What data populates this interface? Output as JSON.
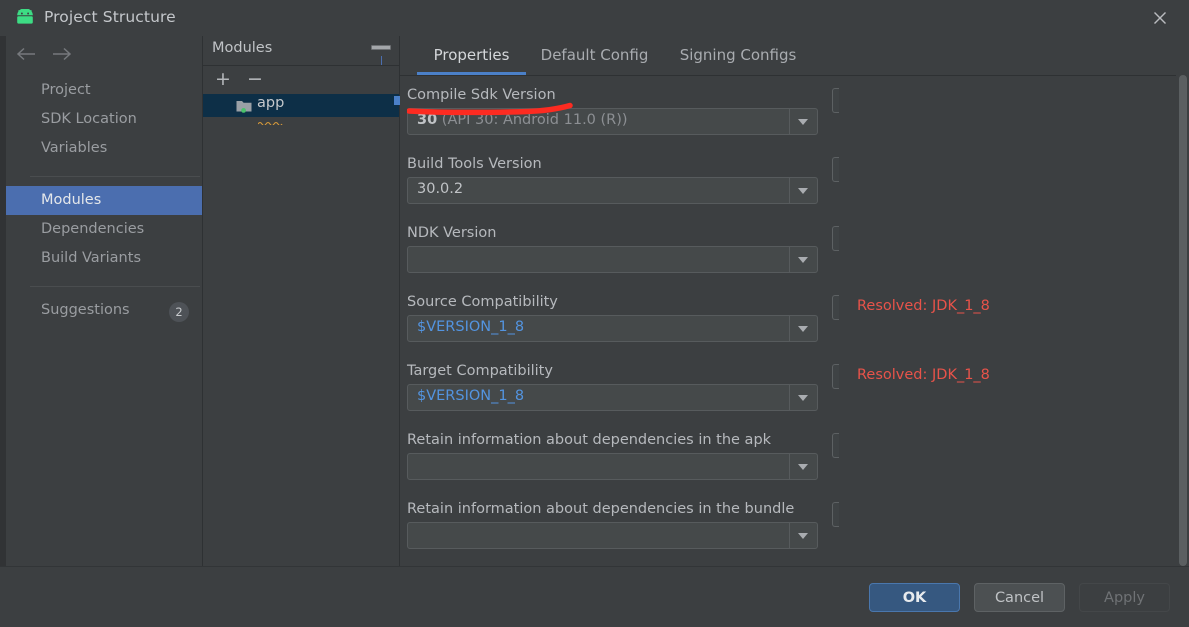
{
  "window": {
    "title": "Project Structure",
    "app_icon": "android-bot-icon",
    "close_icon": "close-icon"
  },
  "nav": {
    "back_icon": "arrow-left-icon",
    "forward_icon": "arrow-right-icon",
    "items": [
      {
        "label": "Project",
        "selected": false
      },
      {
        "label": "SDK Location",
        "selected": false
      },
      {
        "label": "Variables",
        "selected": false
      },
      {
        "label": "Modules",
        "selected": true
      },
      {
        "label": "Dependencies",
        "selected": false
      },
      {
        "label": "Build Variants",
        "selected": false
      },
      {
        "label": "Suggestions",
        "selected": false,
        "badge": "2"
      }
    ]
  },
  "modules_panel": {
    "title": "Modules",
    "minimize_icon": "minimize-icon",
    "add_label": "+",
    "remove_label": "−",
    "items": [
      {
        "label": "app",
        "icon": "module-folder-icon",
        "selected": true
      }
    ]
  },
  "tabs": [
    {
      "label": "Properties",
      "active": true
    },
    {
      "label": "Default Config",
      "active": false
    },
    {
      "label": "Signing Configs",
      "active": false
    }
  ],
  "fields": [
    {
      "label": "Compile Sdk Version",
      "value": "30",
      "value_suffix": " (API 30: Android 11.0 (R))",
      "is_variable": false,
      "resolved": "",
      "annotated": true
    },
    {
      "label": "Build Tools Version",
      "value": "30.0.2",
      "value_suffix": "",
      "is_variable": false,
      "resolved": ""
    },
    {
      "label": "NDK Version",
      "value": "",
      "value_suffix": "",
      "is_variable": false,
      "resolved": ""
    },
    {
      "label": "Source Compatibility",
      "value": "$VERSION_1_8",
      "value_suffix": "",
      "is_variable": true,
      "resolved": "Resolved: JDK_1_8"
    },
    {
      "label": "Target Compatibility",
      "value": "$VERSION_1_8",
      "value_suffix": "",
      "is_variable": true,
      "resolved": "Resolved: JDK_1_8"
    },
    {
      "label": "Retain information about dependencies in the apk",
      "value": "",
      "value_suffix": "",
      "is_variable": false,
      "resolved": ""
    },
    {
      "label": "Retain information about dependencies in the bundle",
      "value": "",
      "value_suffix": "",
      "is_variable": false,
      "resolved": ""
    }
  ],
  "footer": {
    "ok": "OK",
    "cancel": "Cancel",
    "apply": "Apply"
  },
  "colors": {
    "accent": "#4b6eaf",
    "tab_underline": "#4b80c8",
    "error_text": "#e8534a",
    "variable_text": "#5394e0",
    "annotation": "#ff2a22",
    "android_green": "#3ddc84"
  }
}
